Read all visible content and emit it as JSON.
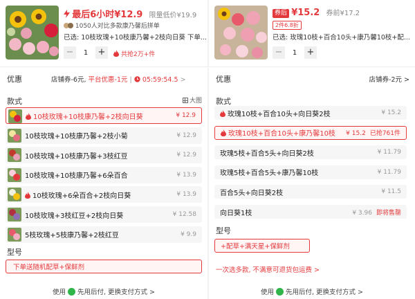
{
  "left": {
    "title_price": "最后6小时¥12.9",
    "limit_label": "限量低价",
    "limit_price": "¥19.9",
    "social": "1050人对比多款康乃馨后拼单",
    "selected": "已选: 10枝玫瑰+10枝康乃馨+2枝向日葵 下单...",
    "qty": "1",
    "grabbed": "共抢2万+件",
    "discount": {
      "label": "优惠",
      "shop": "店铺券-6元,",
      "platform": "平台优惠-1元",
      "timer": "05:59:54.5"
    },
    "style_label": "款式",
    "big_view": "大图",
    "options": [
      {
        "label": "10枝玫瑰+10枝康乃馨+2枝向日葵",
        "price": "¥ 12.9",
        "hot": true,
        "selected": true
      },
      {
        "label": "10枝玫瑰+10枝康乃馨+2枝小菊",
        "price": "¥ 12.9",
        "hot": false,
        "selected": false
      },
      {
        "label": "10枝玫瑰+10枝康乃馨+3枝红豆",
        "price": "¥ 12.9",
        "hot": false,
        "selected": false
      },
      {
        "label": "10枝玫瑰+10枝康乃馨+6朵百合",
        "price": "¥ 13.9",
        "hot": false,
        "selected": false
      },
      {
        "label": "10枝玫瑰+6朵百合+2枝向日葵",
        "price": "¥ 13.9",
        "hot": true,
        "selected": false
      },
      {
        "label": "10枝玫瑰+3枝红豆+2枝向日葵",
        "price": "¥ 12.58",
        "hot": false,
        "selected": false
      },
      {
        "label": "5枝玫瑰+5枝康乃馨+2枝红豆",
        "price": "¥ 9.9",
        "hot": false,
        "selected": false
      }
    ],
    "model_label": "型号",
    "model_option": "下单送随机配草+保鲜剂",
    "footer_pre": "使用",
    "footer_post": "先用后付, 更换支付方式 >"
  },
  "right": {
    "coupon_tag": "券后",
    "coupon_price": "¥15.2",
    "before_label": "券前",
    "before_price": "¥17.2",
    "discount_badge": "2件6.8折",
    "selected": "已选: 玫瑰10枝+百合10头+康乃馨10枝+配...",
    "qty": "1",
    "discount_label": "优惠",
    "shop_coupon": "店铺券-2元 >",
    "style_label": "款式",
    "options": [
      {
        "label": "玫瑰10枝+百合10头+向日葵2枝",
        "price": "¥ 15.2",
        "extra": "",
        "hot": true,
        "selected": false
      },
      {
        "label": "玫瑰10枝+百合10头+康乃馨10枝",
        "price": "¥ 15.2",
        "extra": "已抢761件",
        "hot": true,
        "selected": true
      },
      {
        "label": "玫瑰5枝+百合5头+向日葵2枝",
        "price": "¥ 11.79",
        "extra": "",
        "hot": false,
        "selected": false
      },
      {
        "label": "玫瑰5枝+百合5头+康乃馨10枝",
        "price": "¥ 11.79",
        "extra": "",
        "hot": false,
        "selected": false
      },
      {
        "label": "百合5头+向日葵2枝",
        "price": "¥ 11.5",
        "extra": "",
        "hot": false,
        "selected": false
      },
      {
        "label": "向日葵1枝",
        "price": "¥ 3.96",
        "extra": "即将售罄",
        "hot": false,
        "selected": false
      }
    ],
    "model_label": "型号",
    "model_option": "+配草+满天星+保鲜剂",
    "notice": "一次选多款, 不满意可退货包运费 >",
    "footer_pre": "使用",
    "footer_post": "先用后付, 更换支付方式 >"
  }
}
